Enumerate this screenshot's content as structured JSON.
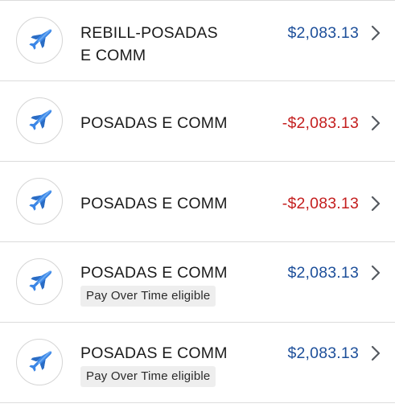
{
  "transactions": [
    {
      "merchant_line1": "REBILL-POSADAS",
      "merchant_line2": "E COMM",
      "amount": "$2,083.13",
      "amount_type": "credit",
      "icon": "airplane-icon",
      "badge": ""
    },
    {
      "merchant_line1": "POSADAS E COMM",
      "amount": "-$2,083.13",
      "amount_type": "refund",
      "icon": "airplane-icon",
      "badge": ""
    },
    {
      "merchant_line1": "POSADAS E COMM",
      "amount": "-$2,083.13",
      "amount_type": "refund",
      "icon": "airplane-icon",
      "badge": ""
    },
    {
      "merchant_line1": "POSADAS E COMM",
      "amount": "$2,083.13",
      "amount_type": "charge",
      "icon": "airplane-icon",
      "badge": "Pay Over Time eligible"
    },
    {
      "merchant_line1": "POSADAS E COMM",
      "amount": "$2,083.13",
      "amount_type": "charge",
      "icon": "airplane-icon",
      "badge": "Pay Over Time eligible"
    }
  ],
  "colors": {
    "positive_amount": "#1d4f9a",
    "negative_amount": "#c41f1f",
    "divider": "#dcdcdc",
    "badge_background": "#eeeeee",
    "icon_blue": "#3b86e6"
  }
}
